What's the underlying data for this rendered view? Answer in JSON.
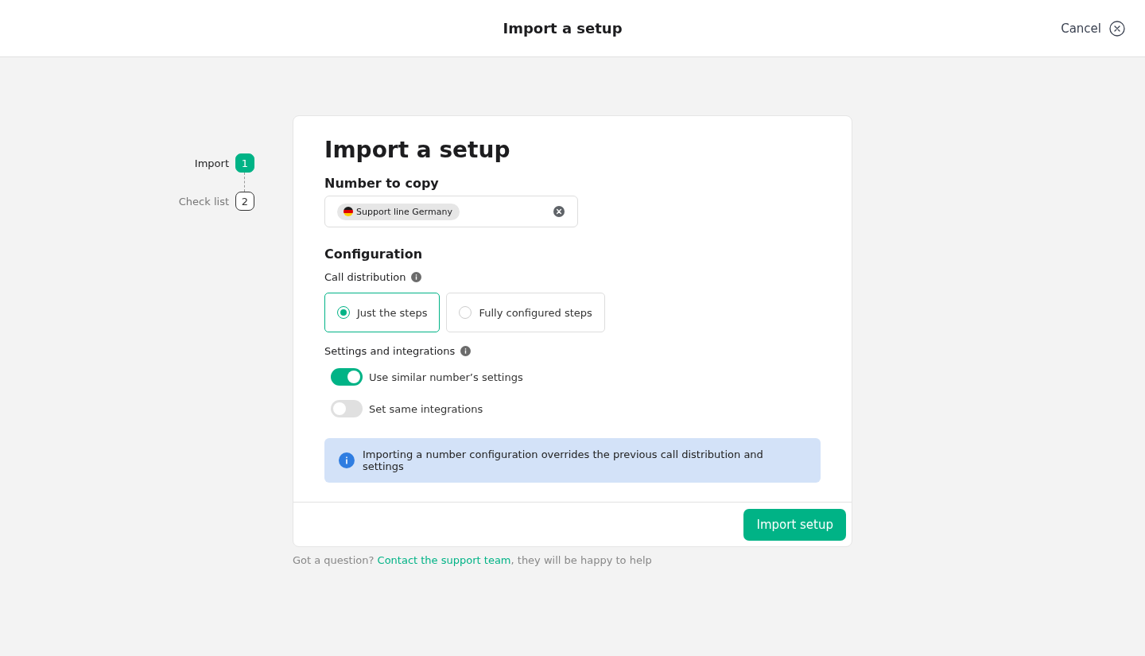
{
  "header": {
    "title": "Import a setup",
    "cancel": "Cancel"
  },
  "steps": [
    {
      "label": "Import",
      "number": "1",
      "selected": true
    },
    {
      "label": "Check list",
      "number": "2",
      "selected": false
    }
  ],
  "card": {
    "title": "Import a setup",
    "number_field": {
      "label": "Number to copy",
      "chip": "Support line Germany"
    },
    "configuration": {
      "title": "Configuration",
      "call_distribution": {
        "label": "Call distribution",
        "options": [
          {
            "label": "Just the steps",
            "selected": true
          },
          {
            "label": "Fully configured steps",
            "selected": false
          }
        ]
      },
      "settings": {
        "label": "Settings and integrations",
        "toggles": [
          {
            "label": "Use similar number’s settings",
            "on": true
          },
          {
            "label": "Set same integrations",
            "on": false
          }
        ]
      }
    },
    "notice": "Importing a number configuration overrides the previous call distribution and settings",
    "button": "Import setup"
  },
  "help": {
    "before": "Got a question? ",
    "link": "Contact the support team",
    "after": ", they will be happy to help"
  }
}
